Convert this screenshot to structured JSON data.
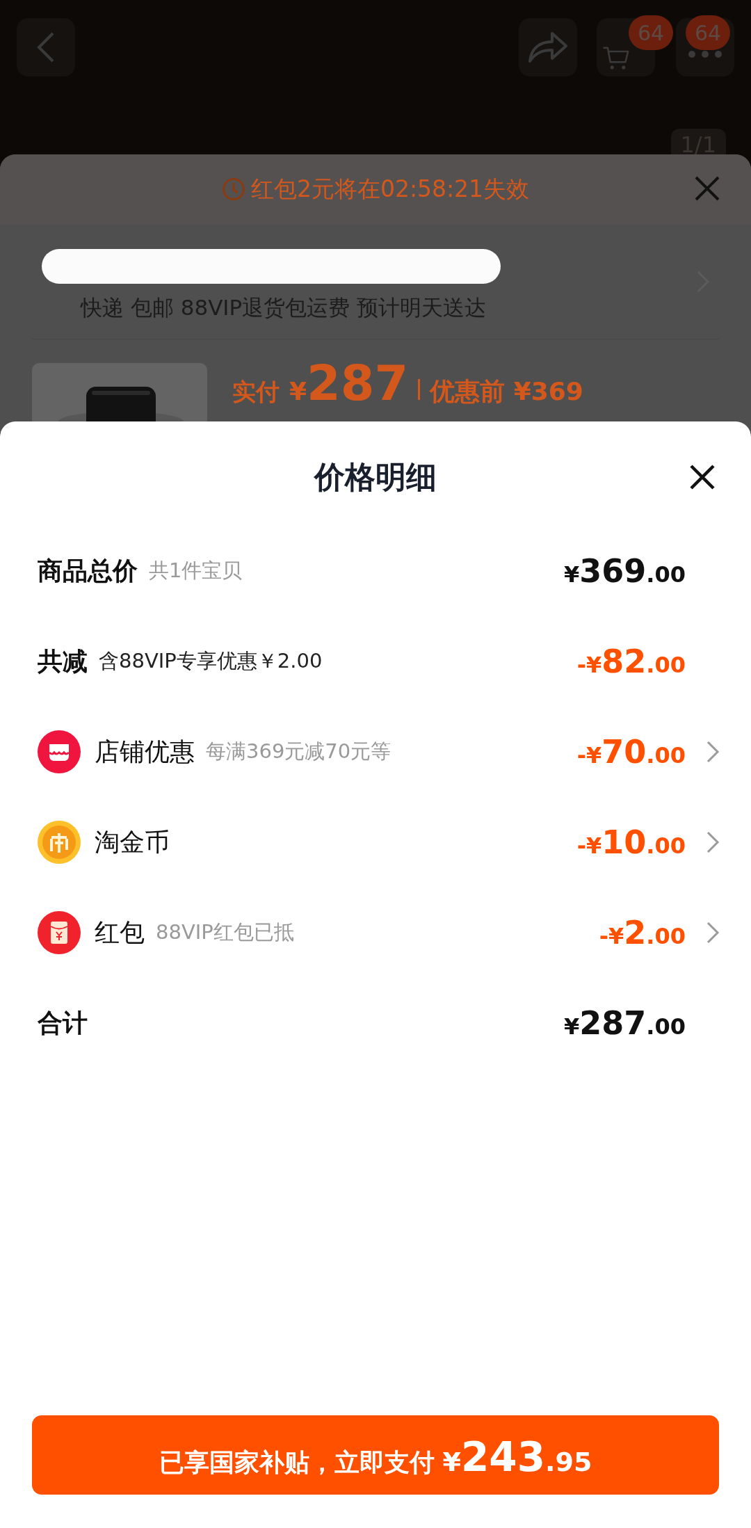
{
  "top_bar": {
    "badges": [
      {
        "count": "64"
      },
      {
        "count": "64"
      }
    ],
    "image_counter": "1/1"
  },
  "order_sheet": {
    "countdown": "红包2元将在02:58:21失效",
    "delivery": "快递 包邮 88VIP退货包运费 预计明天送达",
    "paid_label": "实付",
    "paid_amount": "¥287",
    "original_price": "优惠前 ¥369"
  },
  "price_detail": {
    "title": "价格明细",
    "rows": [
      {
        "kind": "total_price",
        "label": "商品总价",
        "note": "共1件宝贝",
        "amount": "¥369.00",
        "discount": false,
        "expandable": false
      },
      {
        "kind": "savings",
        "label": "共减",
        "note": "含88VIP专享优惠￥2.00",
        "amount": "-¥82.00",
        "discount": true,
        "expandable": false
      },
      {
        "kind": "store",
        "label": "店铺优惠",
        "note": "每满369元减70元等",
        "amount": "-¥70.00",
        "discount": true,
        "expandable": true
      },
      {
        "kind": "coin",
        "label": "淘金币",
        "amount": "-¥10.00",
        "discount": true,
        "expandable": true
      },
      {
        "kind": "red_packet",
        "label": "红包",
        "note": "88VIP红包已抵",
        "amount": "-¥2.00",
        "discount": true,
        "expandable": true
      }
    ],
    "total": {
      "label": "合计",
      "amount": "¥287.00"
    }
  },
  "pay_button": {
    "label": "已享国家补贴，立即支付",
    "amount": "¥243.95"
  }
}
